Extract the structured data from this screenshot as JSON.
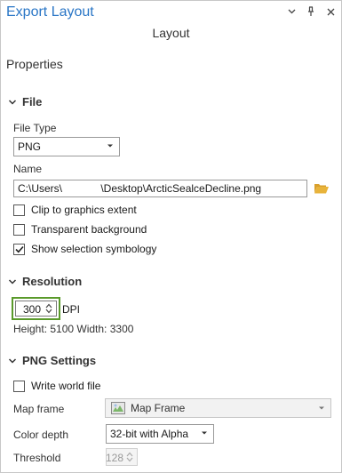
{
  "pane": {
    "title": "Export Layout",
    "subtitle": "Layout",
    "properties_label": "Properties"
  },
  "file": {
    "header": "File",
    "file_type_label": "File Type",
    "file_type_value": "PNG",
    "name_label": "Name",
    "name_value": "C:\\Users\\             \\Desktop\\ArcticSealceDecline.png",
    "clip_label": "Clip to graphics extent",
    "clip_checked": false,
    "transparent_label": "Transparent background",
    "transparent_checked": false,
    "selection_label": "Show selection symbology",
    "selection_checked": true
  },
  "resolution": {
    "header": "Resolution",
    "dpi_value": "300",
    "dpi_unit": "DPI",
    "dimensions": "Height: 5100 Width: 3300"
  },
  "png": {
    "header": "PNG Settings",
    "world_file_label": "Write world file",
    "world_file_checked": false,
    "map_frame_label": "Map frame",
    "map_frame_value": "Map Frame",
    "color_depth_label": "Color depth",
    "color_depth_value": "32-bit with Alpha",
    "threshold_label": "Threshold",
    "threshold_value": "128"
  },
  "colors": {
    "title_blue": "#2a76c6",
    "highlight_green": "#5a9a2b",
    "folder_yellow": "#e8b33a"
  }
}
